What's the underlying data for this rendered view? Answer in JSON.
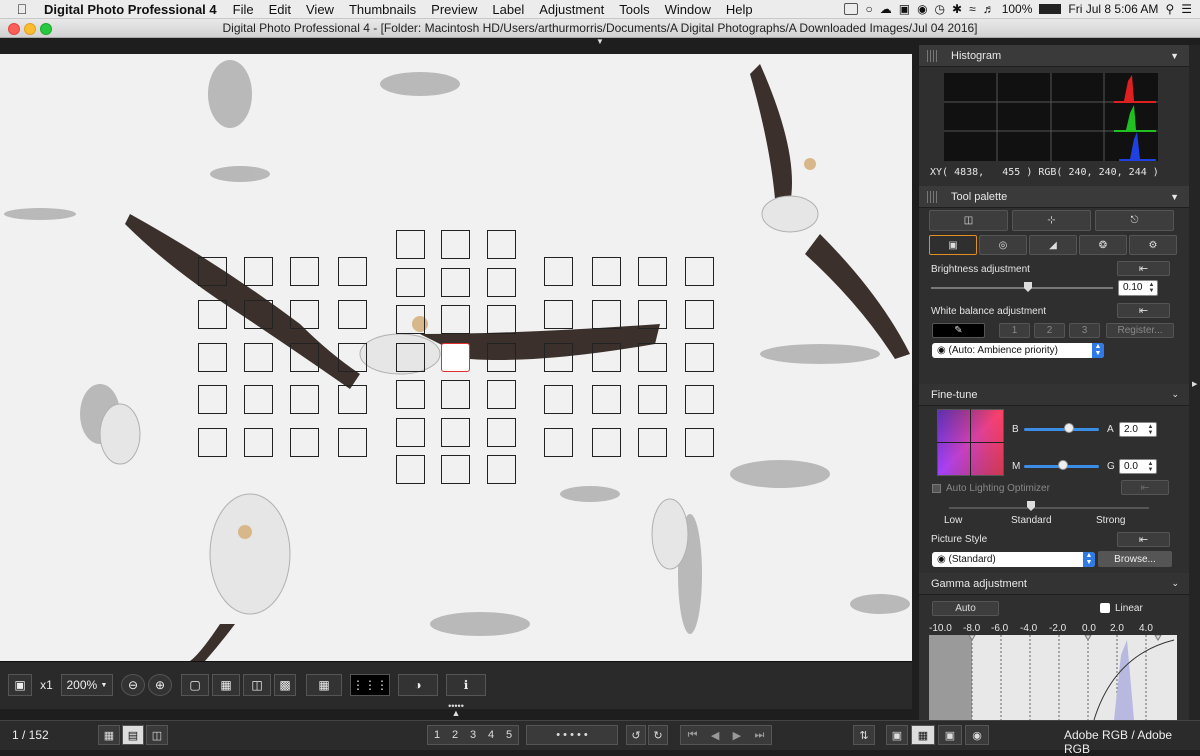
{
  "menubar": {
    "apple": "",
    "app": "Digital Photo Professional 4",
    "items": [
      "File",
      "Edit",
      "View",
      "Thumbnails",
      "Preview",
      "Label",
      "Adjustment",
      "Tools",
      "Window",
      "Help"
    ],
    "battery": "100%",
    "clock": "Fri Jul 8  5:06 AM"
  },
  "titlebar": {
    "title": "Digital Photo Professional 4 - [Folder: Macintosh HD/Users/arthurmorris/Documents/A Digital Photographs/A Downloaded Images/Jul 04 2016]"
  },
  "viewbar": {
    "zoom_mult": "x1",
    "zoom_level": "200%"
  },
  "bottombar": {
    "counter": "1 / 152",
    "ratings": [
      "1",
      "2",
      "3",
      "4",
      "5"
    ],
    "colorspace": "Adobe RGB / Adobe RGB"
  },
  "histogram": {
    "title": "Histogram",
    "readout": "XY( 4838,   455 ) RGB( 240, 240, 244 )"
  },
  "toolpalette": {
    "title": "Tool palette",
    "brightness_label": "Brightness adjustment",
    "brightness_value": "0.10",
    "wb_label": "White balance adjustment",
    "wb_slots": [
      "1",
      "2",
      "3"
    ],
    "register": "Register...",
    "wb_mode": "(Auto: Ambience priority)"
  },
  "finetune": {
    "title": "Fine-tune",
    "b": "B",
    "a": "A",
    "a_value": "2.0",
    "m": "M",
    "g": "G",
    "g_value": "0.0",
    "alo": "Auto Lighting Optimizer",
    "low": "Low",
    "standard": "Standard",
    "strong": "Strong",
    "picture_style_label": "Picture Style",
    "picture_style": "(Standard)",
    "browse": "Browse..."
  },
  "gamma": {
    "title": "Gamma adjustment",
    "auto": "Auto",
    "linear": "Linear",
    "scale": [
      "-10.0",
      "-8.0",
      "-6.0",
      "-4.0",
      "-2.0",
      "0.0",
      "2.0",
      "4.0"
    ]
  },
  "colors": {
    "accent": "#2f7ae5",
    "af_selected": "#e03030",
    "panel": "#2f2f2f"
  }
}
